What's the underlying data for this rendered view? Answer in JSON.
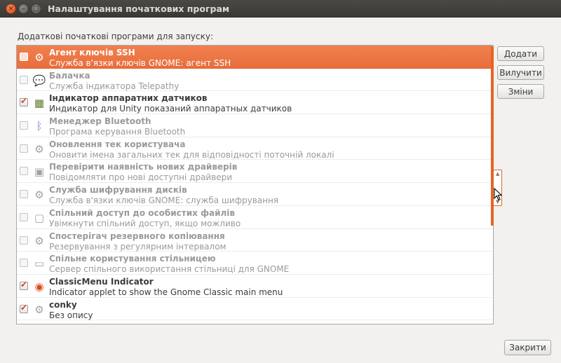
{
  "window": {
    "title": "Налаштування початкових програм",
    "close_glyph": "×",
    "min_glyph": "–",
    "max_glyph": "□"
  },
  "section_label": "Додаткові початкові програми для запуску:",
  "programs": [
    {
      "name": "Агент ключів SSH",
      "description": "Служба в'язки ключів GNOME: агент SSH",
      "checked": false,
      "enabled": true,
      "selected": true,
      "icon": "gears-icon"
    },
    {
      "name": "Балачка",
      "description": "Служба індикатора Telepathy",
      "checked": false,
      "enabled": false,
      "selected": false,
      "icon": "chat-bubble-icon"
    },
    {
      "name": "Індикатор аппаратних датчиков",
      "description": "Индикатор для Unity показаний аппаратных датчиков",
      "checked": true,
      "enabled": true,
      "selected": false,
      "icon": "hardware-chip-icon"
    },
    {
      "name": "Менеджер Bluetooth",
      "description": "Програма керування Bluetooth",
      "checked": false,
      "enabled": false,
      "selected": false,
      "icon": "bluetooth-icon"
    },
    {
      "name": "Оновлення тек користувача",
      "description": "Оновити імена загальних тек для відповідності поточній локалі",
      "checked": false,
      "enabled": false,
      "selected": false,
      "icon": "gears-icon"
    },
    {
      "name": "Перевірити наявність нових драйверів",
      "description": "Повідомляти про нові доступні драйвери",
      "checked": false,
      "enabled": false,
      "selected": false,
      "icon": "driver-chip-icon"
    },
    {
      "name": "Служба шифрування дисків",
      "description": "Служба в'язки ключів GNOME: служба шифрування",
      "checked": false,
      "enabled": false,
      "selected": false,
      "icon": "gears-icon"
    },
    {
      "name": "Спільний доступ до особистих файлів",
      "description": "Увімкнути спільний доступ, якщо можливо",
      "checked": false,
      "enabled": false,
      "selected": false,
      "icon": "folder-share-icon"
    },
    {
      "name": "Спостерігач резервного копіювання",
      "description": "Резервування з регулярним інтервалом",
      "checked": false,
      "enabled": false,
      "selected": false,
      "icon": "gears-icon"
    },
    {
      "name": "Спільне користування стільницею",
      "description": "Сервер спільного використання стільниці для GNOME",
      "checked": false,
      "enabled": false,
      "selected": false,
      "icon": "desktop-share-icon"
    },
    {
      "name": "ClassicMenu Indicator",
      "description": "Indicator applet to show the Gnome Classic main menu",
      "checked": true,
      "enabled": true,
      "selected": false,
      "icon": "ubuntu-logo-icon"
    },
    {
      "name": "conky",
      "description": "Без опису",
      "checked": true,
      "enabled": true,
      "selected": false,
      "icon": "gears-icon"
    }
  ],
  "buttons": {
    "add": "Додати",
    "remove": "Вилучити",
    "edit": "Зміни",
    "close": "Закрити"
  },
  "colors": {
    "accent": "#dd4814",
    "selection": "#ec7647"
  }
}
